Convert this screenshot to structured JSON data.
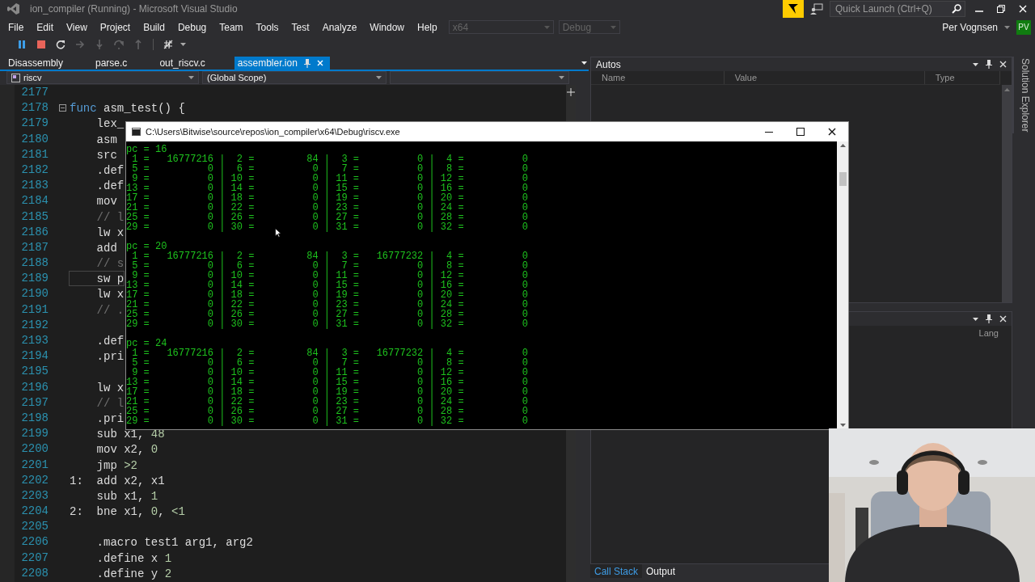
{
  "window": {
    "title": "ion_compiler (Running) - Microsoft Visual Studio"
  },
  "quick_launch": {
    "placeholder": "Quick Launch (Ctrl+Q)"
  },
  "menu": [
    "File",
    "Edit",
    "View",
    "Project",
    "Build",
    "Debug",
    "Team",
    "Tools",
    "Test",
    "Analyze",
    "Window",
    "Help"
  ],
  "config_dropdowns": [
    {
      "value": "x64",
      "disabled": true
    },
    {
      "value": "Debug",
      "disabled": true
    }
  ],
  "account": {
    "name": "Per Vognsen",
    "initials": "PV"
  },
  "toolbar": [
    {
      "disabled": false
    },
    {
      "disabled": false
    },
    {
      "disabled": false
    },
    {
      "disabled": true
    },
    {
      "disabled": true
    },
    {
      "disabled": true
    },
    {
      "disabled": true
    },
    {
      "disabled": false
    }
  ],
  "doc_tabs": [
    {
      "label": "Disassembly",
      "selected": false
    },
    {
      "label": "parse.c",
      "selected": false
    },
    {
      "label": "out_riscv.c",
      "selected": false
    },
    {
      "label": "assembler.ion",
      "selected": true
    }
  ],
  "nav": {
    "project": "riscv",
    "scope": "(Global Scope)"
  },
  "editor": {
    "lines": [
      {
        "number": "2177"
      },
      {
        "number": "2178",
        "fold": true,
        "code": [
          {
            "text": "func",
            "kind": "keyword"
          },
          {
            "text": " asm_test() {",
            "kind": "plain"
          }
        ]
      },
      {
        "number": "2179",
        "code": [
          {
            "text": "    lex_",
            "kind": "plain"
          }
        ]
      },
      {
        "number": "2180",
        "code": [
          {
            "text": "    asm",
            "kind": "plain"
          }
        ]
      },
      {
        "number": "2181",
        "code": [
          {
            "text": "    src",
            "kind": "plain"
          }
        ]
      },
      {
        "number": "2182",
        "code": [
          {
            "text": "    .def",
            "kind": "plain"
          }
        ]
      },
      {
        "number": "2183",
        "code": [
          {
            "text": "    .def",
            "kind": "plain"
          }
        ]
      },
      {
        "number": "2184",
        "code": [
          {
            "text": "    mov",
            "kind": "plain"
          }
        ]
      },
      {
        "number": "2185",
        "code": [
          {
            "text": "    // l",
            "kind": "comment"
          }
        ]
      },
      {
        "number": "2186",
        "code": [
          {
            "text": "    lw x",
            "kind": "plain"
          }
        ]
      },
      {
        "number": "2187",
        "code": [
          {
            "text": "    add",
            "kind": "plain"
          }
        ]
      },
      {
        "number": "2188",
        "code": [
          {
            "text": "    // s",
            "kind": "comment"
          }
        ]
      },
      {
        "number": "2189",
        "current": true,
        "code": [
          {
            "text": "    sw p",
            "kind": "plain"
          }
        ]
      },
      {
        "number": "2190",
        "code": [
          {
            "text": "    lw x",
            "kind": "plain"
          }
        ]
      },
      {
        "number": "2191",
        "code": [
          {
            "text": "    // .",
            "kind": "comment"
          }
        ]
      },
      {
        "number": "2192"
      },
      {
        "number": "2193",
        "code": [
          {
            "text": "    .def",
            "kind": "plain"
          }
        ]
      },
      {
        "number": "2194",
        "code": [
          {
            "text": "    .pri",
            "kind": "plain"
          }
        ]
      },
      {
        "number": "2195"
      },
      {
        "number": "2196",
        "code": [
          {
            "text": "    lw x",
            "kind": "plain"
          }
        ]
      },
      {
        "number": "2197",
        "code": [
          {
            "text": "    // l",
            "kind": "comment"
          }
        ]
      },
      {
        "number": "2198",
        "code": [
          {
            "text": "    .pri",
            "kind": "plain"
          }
        ]
      },
      {
        "number": "2199",
        "code": [
          {
            "text": "    sub x1, ",
            "kind": "plain"
          },
          {
            "text": "48",
            "kind": "number"
          }
        ]
      },
      {
        "number": "2200",
        "code": [
          {
            "text": "    mov x2, ",
            "kind": "plain"
          },
          {
            "text": "0",
            "kind": "number"
          }
        ]
      },
      {
        "number": "2201",
        "code": [
          {
            "text": "    jmp ",
            "kind": "plain"
          },
          {
            "text": ">2",
            "kind": "number"
          }
        ]
      },
      {
        "number": "2202",
        "code": [
          {
            "text": "1:  add x2, x1",
            "kind": "plain"
          }
        ]
      },
      {
        "number": "2203",
        "code": [
          {
            "text": "    sub x1, ",
            "kind": "plain"
          },
          {
            "text": "1",
            "kind": "number"
          }
        ]
      },
      {
        "number": "2204",
        "code": [
          {
            "text": "2:  bne x1, ",
            "kind": "plain"
          },
          {
            "text": "0",
            "kind": "number"
          },
          {
            "text": ", ",
            "kind": "plain"
          },
          {
            "text": "<1",
            "kind": "number"
          }
        ]
      },
      {
        "number": "2205"
      },
      {
        "number": "2206",
        "code": [
          {
            "text": "    .macro test1 arg1, arg2",
            "kind": "plain"
          }
        ]
      },
      {
        "number": "2207",
        "code": [
          {
            "text": "    .define x ",
            "kind": "plain"
          },
          {
            "text": "1",
            "kind": "number"
          }
        ]
      },
      {
        "number": "2208",
        "code": [
          {
            "text": "    .define y ",
            "kind": "plain"
          },
          {
            "text": "2",
            "kind": "number"
          }
        ]
      }
    ]
  },
  "autos": {
    "title": "Autos",
    "columns": [
      "Name",
      "Value",
      "Type"
    ]
  },
  "call_stack": {
    "visible_columns": [
      "Lang"
    ]
  },
  "bottom_tabs": [
    {
      "label": "Call Stack",
      "selected": true
    },
    {
      "label": "Output",
      "selected": false
    }
  ],
  "side_tabs": [
    "Solution Explorer"
  ],
  "console": {
    "title": "C:\\Users\\Bitwise\\source\\repos\\ion_compiler\\x64\\Debug\\riscv.exe",
    "blocks": [
      {
        "header": "pc = 16",
        "rows": [
          " 1 =   16777216 |  2 =         84 |  3 =          0 |  4 =          0",
          " 5 =          0 |  6 =          0 |  7 =          0 |  8 =          0",
          " 9 =          0 | 10 =          0 | 11 =          0 | 12 =          0",
          "13 =          0 | 14 =          0 | 15 =          0 | 16 =          0",
          "17 =          0 | 18 =          0 | 19 =          0 | 20 =          0",
          "21 =          0 | 22 =          0 | 23 =          0 | 24 =          0",
          "25 =          0 | 26 =          0 | 27 =          0 | 28 =          0",
          "29 =          0 | 30 =          0 | 31 =          0 | 32 =          0"
        ]
      },
      {
        "header": "pc = 20",
        "rows": [
          " 1 =   16777216 |  2 =         84 |  3 =   16777232 |  4 =          0",
          " 5 =          0 |  6 =          0 |  7 =          0 |  8 =          0",
          " 9 =          0 | 10 =          0 | 11 =          0 | 12 =          0",
          "13 =          0 | 14 =          0 | 15 =          0 | 16 =          0",
          "17 =          0 | 18 =          0 | 19 =          0 | 20 =          0",
          "21 =          0 | 22 =          0 | 23 =          0 | 24 =          0",
          "25 =          0 | 26 =          0 | 27 =          0 | 28 =          0",
          "29 =          0 | 30 =          0 | 31 =          0 | 32 =          0"
        ]
      },
      {
        "header": "pc = 24",
        "rows": [
          " 1 =   16777216 |  2 =         84 |  3 =   16777232 |  4 =          0",
          " 5 =          0 |  6 =          0 |  7 =          0 |  8 =          0",
          " 9 =          0 | 10 =          0 | 11 =          0 | 12 =          0",
          "13 =          0 | 14 =          0 | 15 =          0 | 16 =          0",
          "17 =          0 | 18 =          0 | 19 =          0 | 20 =          0",
          "21 =          0 | 22 =          0 | 23 =          0 | 24 =          0",
          "25 =          0 | 26 =          0 | 27 =          0 | 28 =          0",
          "29 =          0 | 30 =          0 | 31 =          0 | 32 =          0"
        ]
      }
    ]
  },
  "webcam": {
    "kind": "picture"
  }
}
